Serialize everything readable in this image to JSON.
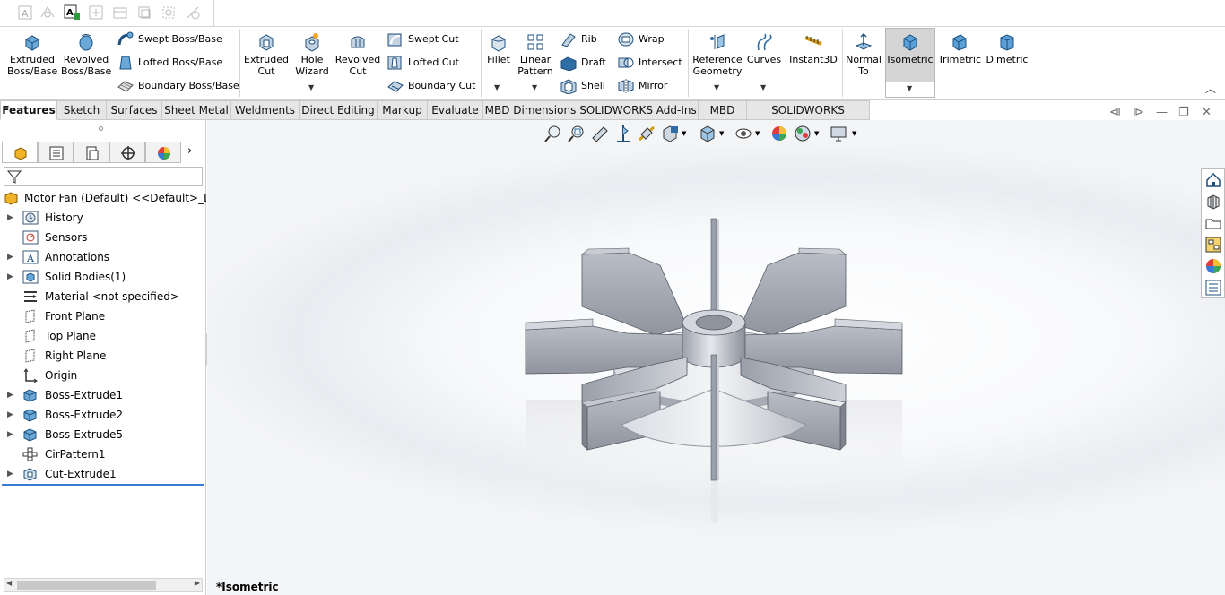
{
  "ribbon": {
    "features": {
      "extruded_boss": "Extruded\nBoss/Base",
      "revolved_boss": "Revolved\nBoss/Base",
      "swept_boss": "Swept Boss/Base",
      "lofted_boss": "Lofted Boss/Base",
      "boundary_boss": "Boundary Boss/Base",
      "extruded_cut": "Extruded\nCut",
      "hole_wizard": "Hole\nWizard",
      "revolved_cut": "Revolved\nCut",
      "swept_cut": "Swept Cut",
      "lofted_cut": "Lofted Cut",
      "boundary_cut": "Boundary Cut",
      "fillet": "Fillet",
      "linear_pattern": "Linear\nPattern",
      "rib": "Rib",
      "draft": "Draft",
      "shell": "Shell",
      "wrap": "Wrap",
      "intersect": "Intersect",
      "mirror": "Mirror",
      "reference_geometry": "Reference\nGeometry",
      "curves": "Curves",
      "instant3d": "Instant3D",
      "normal_to": "Normal\nTo",
      "isometric": "Isometric",
      "trimetric": "Trimetric",
      "dimetric": "Dimetric"
    }
  },
  "tabs": [
    {
      "label": "Features",
      "active": true
    },
    {
      "label": "Sketch"
    },
    {
      "label": "Surfaces"
    },
    {
      "label": "Sheet Metal"
    },
    {
      "label": "Weldments"
    },
    {
      "label": "Direct Editing"
    },
    {
      "label": "Markup"
    },
    {
      "label": "Evaluate"
    },
    {
      "label": "MBD Dimensions"
    },
    {
      "label": "SOLIDWORKS Add-Ins"
    },
    {
      "label": "MBD"
    },
    {
      "label": "SOLIDWORKS Visualize"
    }
  ],
  "tree": {
    "root": "Motor Fan (Default) <<Default>_Displ",
    "items": [
      {
        "label": "History",
        "icon": "history-icon",
        "expandable": true
      },
      {
        "label": "Sensors",
        "icon": "sensors-icon",
        "expandable": false
      },
      {
        "label": "Annotations",
        "icon": "annotations-icon",
        "expandable": true
      },
      {
        "label": "Solid Bodies(1)",
        "icon": "solid-bodies-icon",
        "expandable": true
      },
      {
        "label": "Material <not specified>",
        "icon": "material-icon",
        "expandable": false
      },
      {
        "label": "Front Plane",
        "icon": "plane-icon",
        "expandable": false
      },
      {
        "label": "Top Plane",
        "icon": "plane-icon",
        "expandable": false
      },
      {
        "label": "Right Plane",
        "icon": "plane-icon",
        "expandable": false
      },
      {
        "label": "Origin",
        "icon": "origin-icon",
        "expandable": false
      },
      {
        "label": "Boss-Extrude1",
        "icon": "extrude-icon",
        "expandable": true
      },
      {
        "label": "Boss-Extrude2",
        "icon": "extrude-icon",
        "expandable": true
      },
      {
        "label": "Boss-Extrude5",
        "icon": "extrude-icon",
        "expandable": true
      },
      {
        "label": "CirPattern1",
        "icon": "circular-pattern-icon",
        "expandable": false
      },
      {
        "label": "Cut-Extrude1",
        "icon": "cut-extrude-icon",
        "expandable": true
      }
    ]
  },
  "viewport": {
    "view_name": "*Isometric"
  },
  "colors": {
    "accent": "#3a7ad6",
    "part_gray": "#a9adb6",
    "active_tool": "#d4d4d4"
  }
}
